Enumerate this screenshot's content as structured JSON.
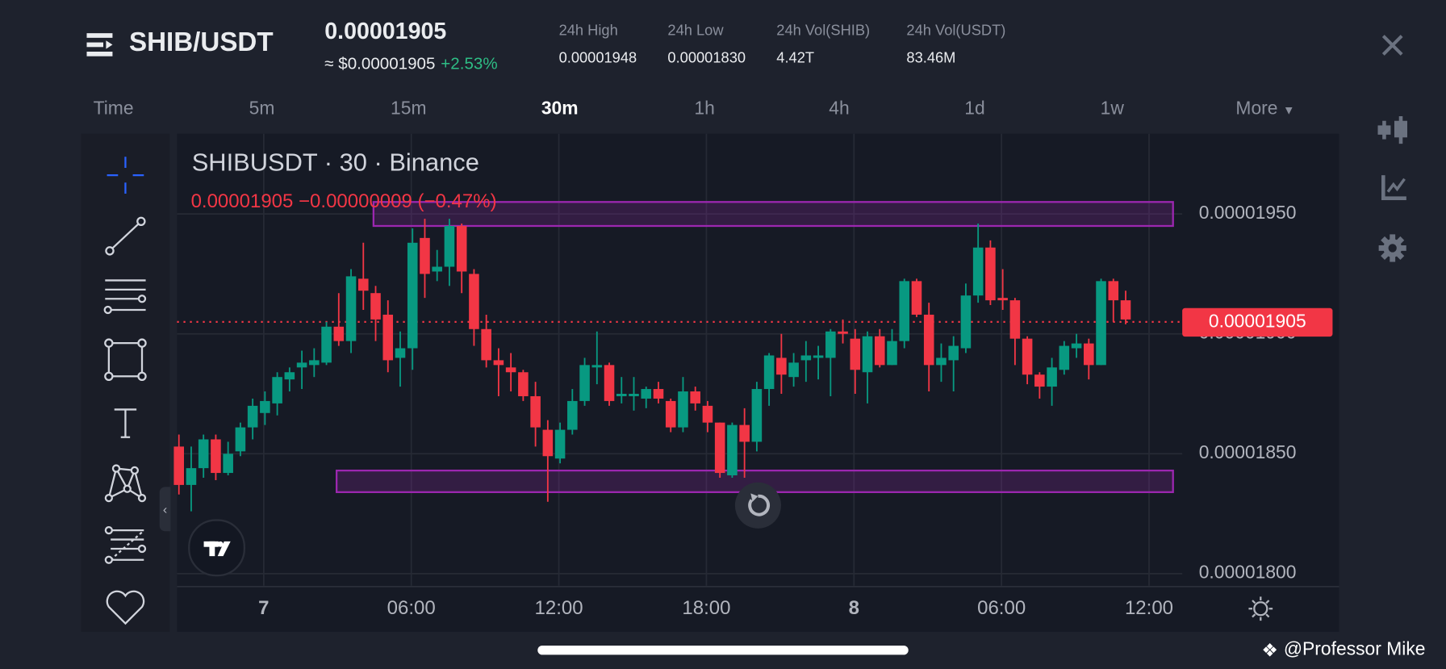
{
  "header": {
    "pair": "SHIB/USDT",
    "last_price": "0.00001905",
    "approx_usd": "≈ $0.00001905",
    "change_pct": "+2.53%",
    "stats": [
      {
        "label": "24h High",
        "value": "0.00001948"
      },
      {
        "label": "24h Low",
        "value": "0.00001830"
      },
      {
        "label": "24h Vol(SHIB)",
        "value": "4.42T"
      },
      {
        "label": "24h Vol(USDT)",
        "value": "83.46M"
      }
    ]
  },
  "timeframes": [
    "Time",
    "5m",
    "15m",
    "30m",
    "1h",
    "4h",
    "1d",
    "1w",
    "More"
  ],
  "active_timeframe": "30m",
  "chart": {
    "title": "SHIBUSDT · 30 · Binance",
    "legend": "0.00001905 −0.00000009 (−0.47%)",
    "current_price_label": "0.00001905",
    "price_labels": [
      "0.00001950",
      "0.00001900",
      "0.00001850",
      "0.00001800"
    ],
    "time_labels": [
      "7",
      "06:00",
      "12:00",
      "18:00",
      "8",
      "06:00",
      "12:00"
    ]
  },
  "watermark": "@Professor Mike",
  "colors": {
    "up": "#089981",
    "down": "#f23645",
    "zone": "#9c27b0",
    "accent": "#2962ff"
  },
  "chart_data": {
    "type": "candlestick",
    "title": "SHIBUSDT · 30 · Binance",
    "interval": "30m",
    "price_unit": "1e-8 USDT",
    "ylim": [
      1790,
      1975
    ],
    "start": "6th 20:30",
    "ohlc": [
      [
        1853,
        1858,
        1833,
        1837
      ],
      [
        1837,
        1853,
        1826,
        1844
      ],
      [
        1844,
        1858,
        1840,
        1856
      ],
      [
        1856,
        1858,
        1839,
        1842
      ],
      [
        1842,
        1855,
        1841,
        1850
      ],
      [
        1851,
        1863,
        1849,
        1861
      ],
      [
        1861,
        1873,
        1856,
        1870
      ],
      [
        1867,
        1876,
        1862,
        1872
      ],
      [
        1871,
        1884,
        1866,
        1882
      ],
      [
        1881,
        1886,
        1876,
        1884
      ],
      [
        1886,
        1893,
        1877,
        1888
      ],
      [
        1887,
        1894,
        1882,
        1889
      ],
      [
        1888,
        1905,
        1887,
        1903
      ],
      [
        1903,
        1917,
        1895,
        1897
      ],
      [
        1897,
        1927,
        1892,
        1924
      ],
      [
        1923,
        1938,
        1910,
        1918
      ],
      [
        1917,
        1920,
        1897,
        1906
      ],
      [
        1908,
        1914,
        1884,
        1889
      ],
      [
        1890,
        1901,
        1878,
        1894
      ],
      [
        1894,
        1944,
        1885,
        1938
      ],
      [
        1940,
        1948,
        1915,
        1925
      ],
      [
        1926,
        1935,
        1922,
        1928
      ],
      [
        1928,
        1948,
        1920,
        1945
      ],
      [
        1945,
        1946,
        1917,
        1926
      ],
      [
        1925,
        1927,
        1895,
        1902
      ],
      [
        1902,
        1908,
        1886,
        1889
      ],
      [
        1889,
        1894,
        1874,
        1887
      ],
      [
        1886,
        1892,
        1876,
        1884
      ],
      [
        1884,
        1885,
        1872,
        1874
      ],
      [
        1874,
        1880,
        1853,
        1861
      ],
      [
        1860,
        1864,
        1830,
        1849
      ],
      [
        1848,
        1863,
        1846,
        1860
      ],
      [
        1860,
        1877,
        1858,
        1872
      ],
      [
        1872,
        1890,
        1870,
        1887
      ],
      [
        1886,
        1901,
        1879,
        1887
      ],
      [
        1887,
        1888,
        1870,
        1872
      ],
      [
        1874,
        1882,
        1871,
        1875
      ],
      [
        1874,
        1882,
        1868,
        1875
      ],
      [
        1873,
        1878,
        1869,
        1877
      ],
      [
        1877,
        1880,
        1871,
        1873
      ],
      [
        1872,
        1873,
        1859,
        1861
      ],
      [
        1861,
        1882,
        1859,
        1876
      ],
      [
        1876,
        1878,
        1868,
        1871
      ],
      [
        1870,
        1872,
        1859,
        1863
      ],
      [
        1863,
        1863,
        1840,
        1842
      ],
      [
        1841,
        1863,
        1840,
        1862
      ],
      [
        1862,
        1869,
        1840,
        1855
      ],
      [
        1855,
        1880,
        1851,
        1877
      ],
      [
        1877,
        1892,
        1870,
        1891
      ],
      [
        1890,
        1900,
        1875,
        1883
      ],
      [
        1882,
        1892,
        1878,
        1888
      ],
      [
        1889,
        1897,
        1880,
        1891
      ],
      [
        1890,
        1895,
        1881,
        1891
      ],
      [
        1890,
        1902,
        1874,
        1901
      ],
      [
        1901,
        1906,
        1896,
        1900
      ],
      [
        1898,
        1902,
        1875,
        1885
      ],
      [
        1884,
        1901,
        1871,
        1899
      ],
      [
        1899,
        1902,
        1886,
        1887
      ],
      [
        1887,
        1902,
        1887,
        1897
      ],
      [
        1897,
        1923,
        1894,
        1922
      ],
      [
        1922,
        1923,
        1907,
        1908
      ],
      [
        1908,
        1913,
        1876,
        1887
      ],
      [
        1887,
        1896,
        1880,
        1890
      ],
      [
        1889,
        1899,
        1876,
        1895
      ],
      [
        1894,
        1921,
        1892,
        1916
      ],
      [
        1916,
        1946,
        1913,
        1936
      ],
      [
        1936,
        1939,
        1912,
        1914
      ],
      [
        1915,
        1927,
        1910,
        1914
      ],
      [
        1914,
        1915,
        1887,
        1898
      ],
      [
        1898,
        1899,
        1879,
        1883
      ],
      [
        1883,
        1884,
        1873,
        1878
      ],
      [
        1878,
        1890,
        1870,
        1886
      ],
      [
        1885,
        1897,
        1883,
        1895
      ],
      [
        1894,
        1900,
        1890,
        1896
      ],
      [
        1896,
        1898,
        1881,
        1887
      ],
      [
        1887,
        1923,
        1887,
        1922
      ],
      [
        1922,
        1923,
        1905,
        1914
      ],
      [
        1914,
        1918,
        1904,
        1906
      ]
    ],
    "zones": [
      {
        "name": "resistance",
        "low": 1945,
        "high": 1955
      },
      {
        "name": "support",
        "low": 1834,
        "high": 1843
      }
    ],
    "current_price": 1905
  }
}
